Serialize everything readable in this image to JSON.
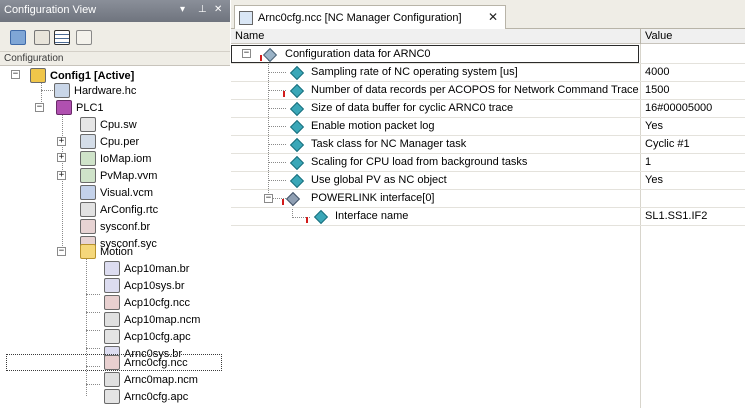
{
  "left_panel": {
    "title": "Configuration View",
    "controls": {
      "dropdown": "▾",
      "pin": "⊥",
      "close": "✕"
    },
    "subheader": "Configuration",
    "tree": [
      {
        "label": "Config1 [Active]",
        "icon": "config-icon",
        "bold": true
      },
      {
        "label": "Hardware.hc",
        "icon": "hardware-file-icon"
      },
      {
        "label": "PLC1",
        "icon": "plc-icon"
      },
      {
        "label": "Cpu.sw",
        "icon": "software-file-icon"
      },
      {
        "label": "Cpu.per",
        "icon": "permanent-file-icon"
      },
      {
        "label": "IoMap.iom",
        "icon": "iomap-file-icon"
      },
      {
        "label": "PvMap.vvm",
        "icon": "pvmap-file-icon"
      },
      {
        "label": "Visual.vcm",
        "icon": "visual-file-icon"
      },
      {
        "label": "ArConfig.rtc",
        "icon": "arconfig-file-icon"
      },
      {
        "label": "sysconf.br",
        "icon": "sysconf-br-icon"
      },
      {
        "label": "sysconf.syc",
        "icon": "sysconf-syc-icon"
      },
      {
        "label": "Motion",
        "icon": "folder-icon"
      },
      {
        "label": "Acp10man.br",
        "icon": "acp10man-file-icon"
      },
      {
        "label": "Acp10sys.br",
        "icon": "acp10sys-file-icon"
      },
      {
        "label": "Acp10cfg.ncc",
        "icon": "acp10cfg-ncc-icon"
      },
      {
        "label": "Acp10map.ncm",
        "icon": "acp10map-file-icon"
      },
      {
        "label": "Acp10cfg.apc",
        "icon": "acp10cfg-apc-icon"
      },
      {
        "label": "Arnc0sys.br",
        "icon": "arnc0sys-file-icon"
      },
      {
        "label": "Arnc0cfg.ncc",
        "icon": "arnc0cfg-ncc-icon",
        "selected": true
      },
      {
        "label": "Arnc0map.ncm",
        "icon": "arnc0map-file-icon"
      },
      {
        "label": "Arnc0cfg.apc",
        "icon": "arnc0cfg-apc-icon"
      }
    ],
    "toolbar_icons": [
      "properties-icon",
      "new-object-icon",
      "table-view-icon",
      "text-view-icon"
    ]
  },
  "editor": {
    "tab_title": "Arnc0cfg.ncc [NC Manager Configuration]",
    "tab_close": "✕",
    "columns": {
      "name": "Name",
      "value": "Value"
    },
    "rows": [
      {
        "label": "Configuration data for ARNC0",
        "value": ""
      },
      {
        "label": "Sampling rate of NC operating system [us]",
        "value": "4000"
      },
      {
        "label": "Number of data records per ACOPOS for Network Command Trace",
        "value": "1500"
      },
      {
        "label": "Size of data buffer for cyclic ARNC0 trace",
        "value": "16#00005000"
      },
      {
        "label": "Enable motion packet log",
        "value": "Yes"
      },
      {
        "label": "Task class for NC Manager task",
        "value": "Cyclic #1"
      },
      {
        "label": "Scaling for CPU load from background tasks",
        "value": "1"
      },
      {
        "label": "Use global PV as NC object",
        "value": "Yes"
      },
      {
        "label": "POWERLINK interface[0]",
        "value": ""
      },
      {
        "label": "Interface name",
        "value": "SL1.SS1.IF2"
      }
    ],
    "expander_minus": "−"
  }
}
